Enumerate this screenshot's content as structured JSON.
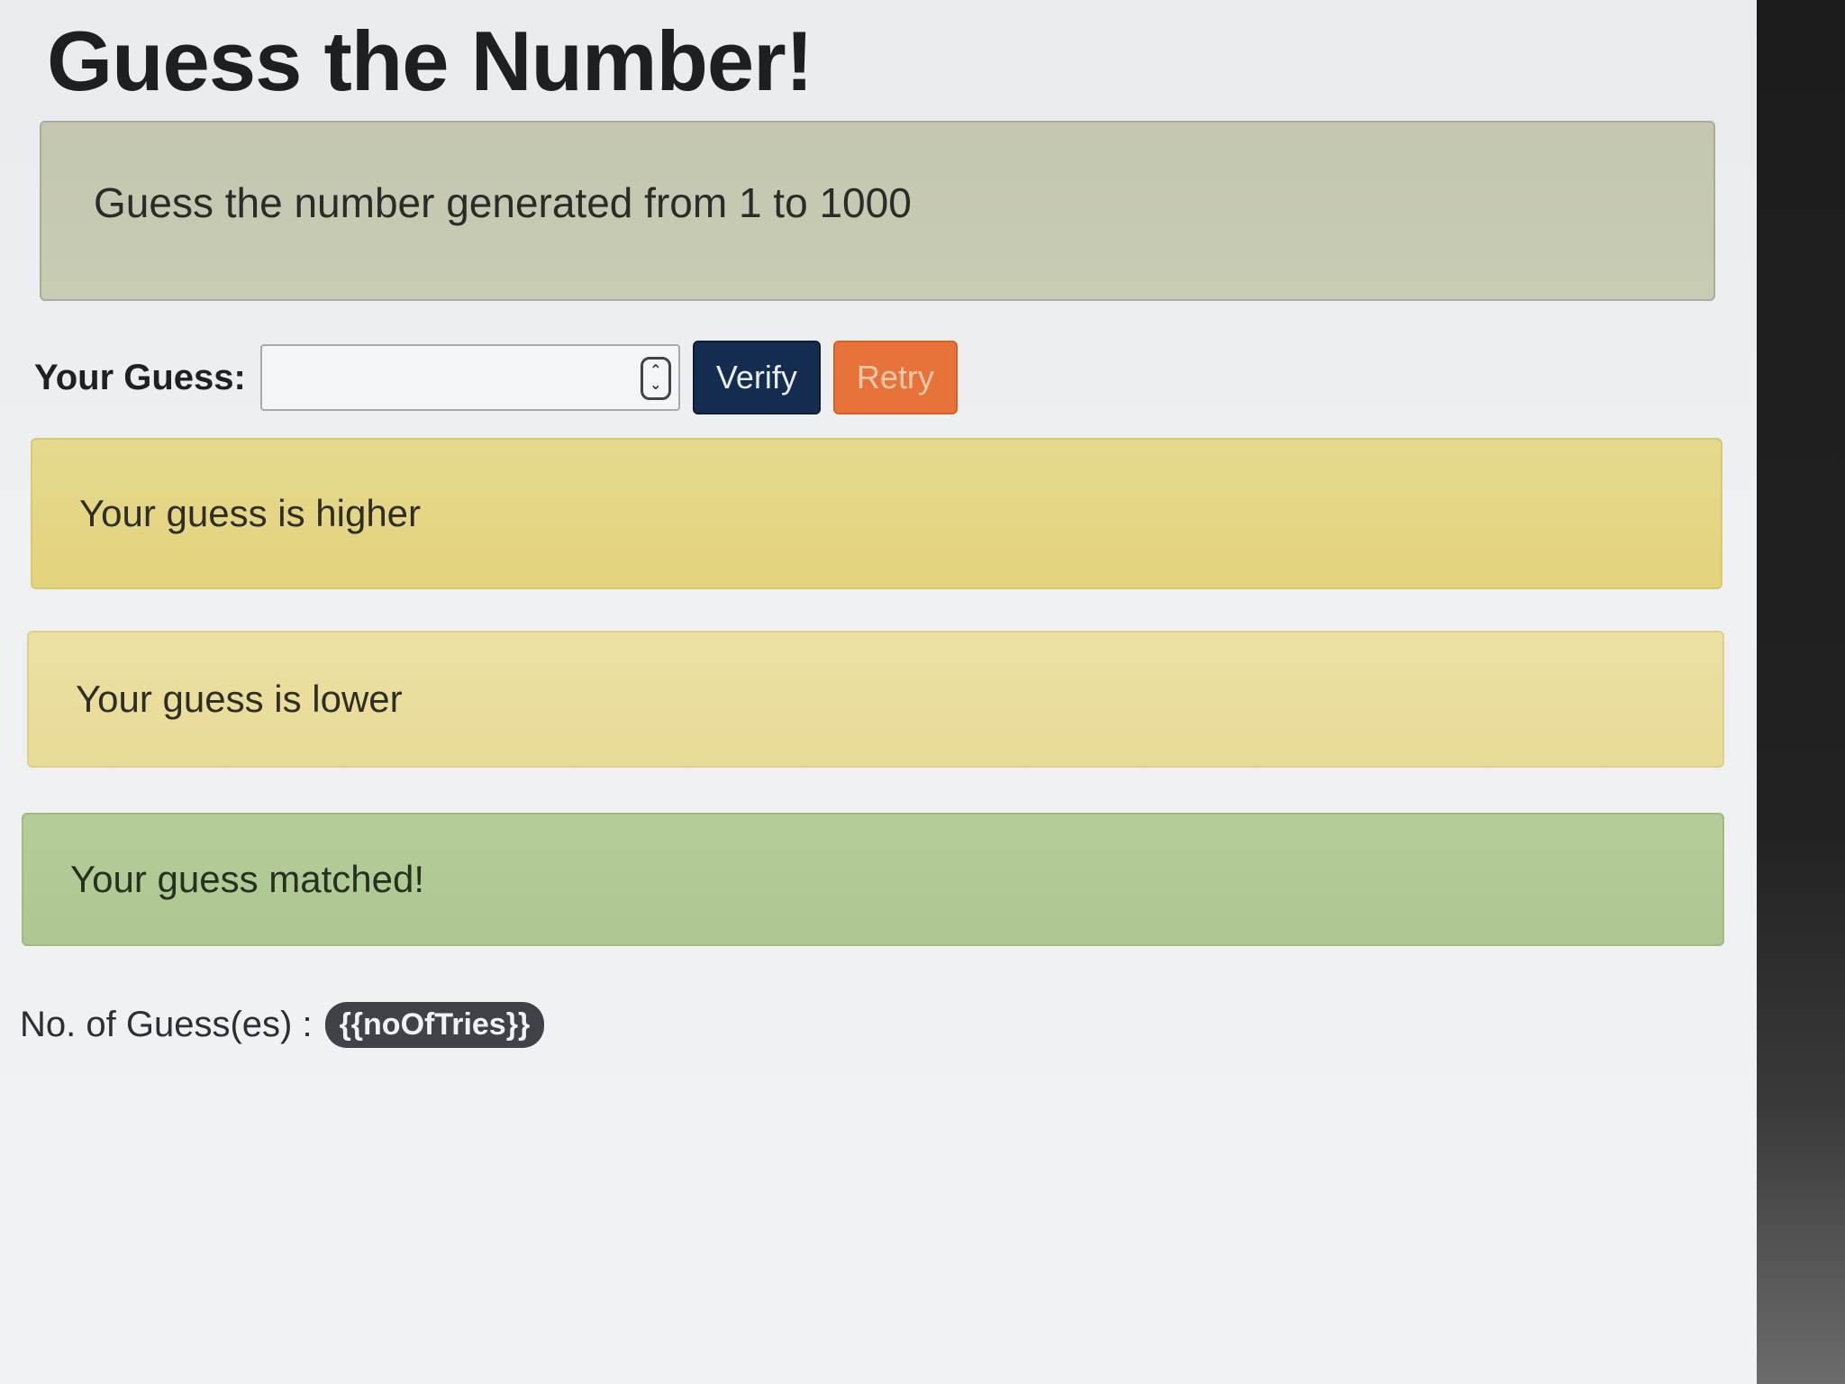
{
  "page": {
    "title": "Guess the Number!",
    "instructions": "Guess the number generated from 1 to 1000"
  },
  "form": {
    "guess_label": "Your Guess:",
    "guess_value": "",
    "verify_label": "Verify",
    "retry_label": "Retry"
  },
  "alerts": {
    "higher": "Your guess is higher",
    "lower": "Your guess is lower",
    "matched": "Your guess matched!"
  },
  "tries": {
    "label": "No. of Guess(es) :",
    "value": "{{noOfTries}}"
  },
  "colors": {
    "verify_button": "#142c4f",
    "retry_button": "#e7733a",
    "alert_warning": "#e3d37e",
    "alert_success": "#aec792",
    "badge": "#3f4348"
  },
  "icons": {
    "spinner": "number-spinner-icon"
  }
}
